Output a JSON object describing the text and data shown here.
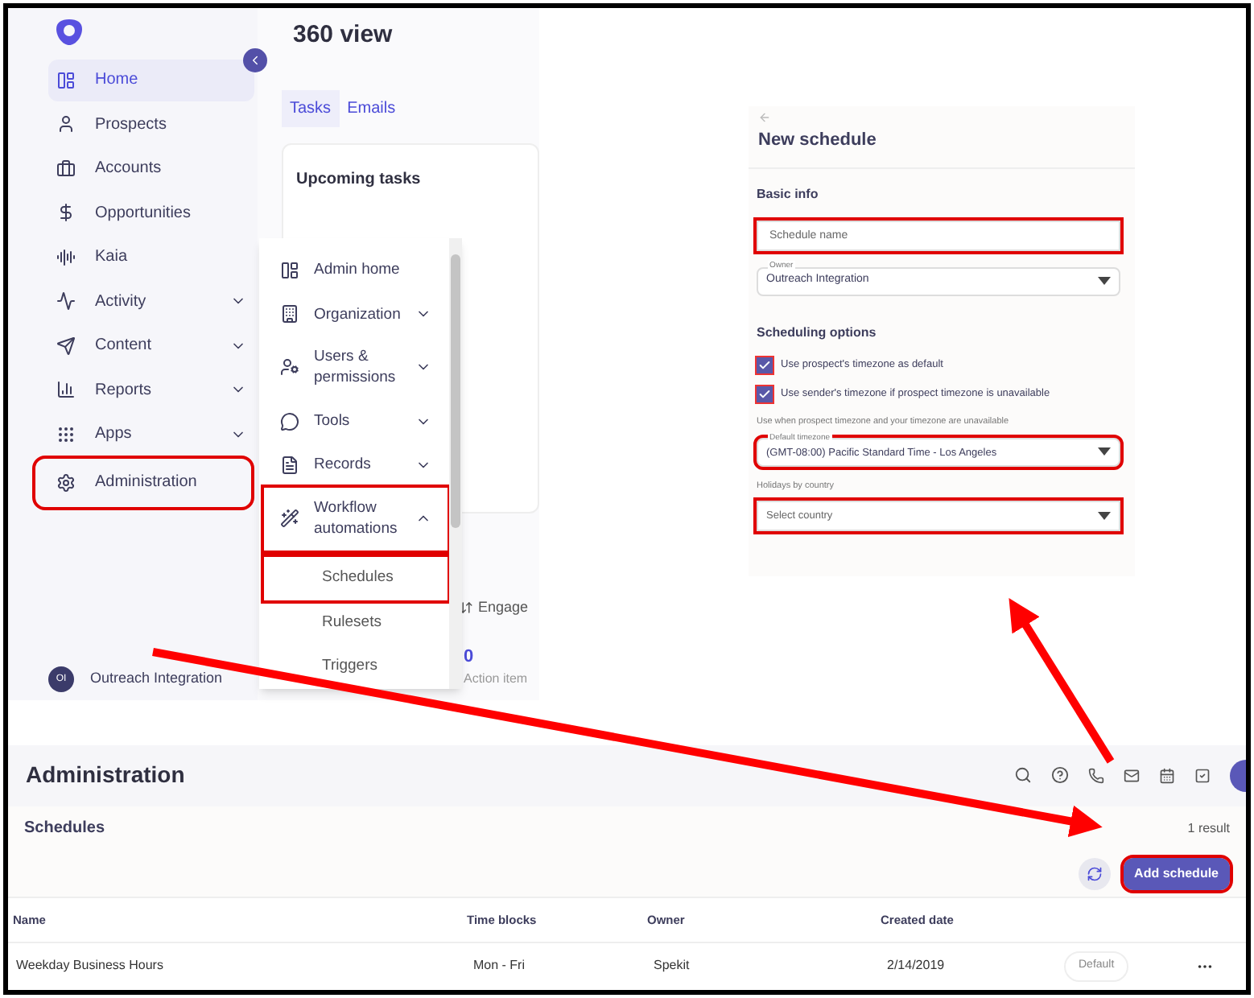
{
  "sidebar": {
    "items": [
      {
        "label": "Home",
        "selected": true,
        "expandable": false,
        "highlighted": false
      },
      {
        "label": "Prospects",
        "selected": false,
        "expandable": false,
        "highlighted": false
      },
      {
        "label": "Accounts",
        "selected": false,
        "expandable": false,
        "highlighted": false
      },
      {
        "label": "Opportunities",
        "selected": false,
        "expandable": false,
        "highlighted": false
      },
      {
        "label": "Kaia",
        "selected": false,
        "expandable": false,
        "highlighted": false
      },
      {
        "label": "Activity",
        "selected": false,
        "expandable": true,
        "highlighted": false
      },
      {
        "label": "Content",
        "selected": false,
        "expandable": true,
        "highlighted": false
      },
      {
        "label": "Reports",
        "selected": false,
        "expandable": true,
        "highlighted": false
      },
      {
        "label": "Apps",
        "selected": false,
        "expandable": true,
        "highlighted": false
      },
      {
        "label": "Administration",
        "selected": false,
        "expandable": false,
        "highlighted": true
      }
    ],
    "user": {
      "initials": "OI",
      "name": "Outreach Integration"
    }
  },
  "admin_menu": {
    "items": [
      {
        "label": "Admin home",
        "kind": "link",
        "expanded": false,
        "highlighted": false
      },
      {
        "label": "Organization",
        "kind": "group",
        "expanded": false,
        "highlighted": false
      },
      {
        "label": "Users & permissions",
        "kind": "group",
        "expanded": false,
        "highlighted": false
      },
      {
        "label": "Tools",
        "kind": "group",
        "expanded": false,
        "highlighted": false
      },
      {
        "label": "Records",
        "kind": "group",
        "expanded": false,
        "highlighted": false
      },
      {
        "label": "Workflow automations",
        "kind": "group",
        "expanded": true,
        "highlighted": true,
        "children": [
          {
            "label": "Schedules",
            "highlighted": true
          },
          {
            "label": "Rulesets",
            "highlighted": false
          },
          {
            "label": "Triggers",
            "highlighted": false
          }
        ]
      }
    ]
  },
  "main": {
    "title": "360 view",
    "tabs": [
      {
        "label": "Tasks",
        "selected": true
      },
      {
        "label": "Emails",
        "selected": false
      }
    ],
    "card_title": "Upcoming tasks",
    "sort_label": "Engage",
    "count": "0",
    "count_label": "Action item"
  },
  "new_schedule": {
    "title": "New schedule",
    "basic_info": "Basic info",
    "name_field": {
      "placeholder": "Schedule name",
      "highlighted": true
    },
    "owner_select": {
      "label": "Owner",
      "value": "Outreach Integration",
      "highlighted": false
    },
    "options_title": "Scheduling options",
    "checkboxes": [
      {
        "label": "Use prospect's timezone as default",
        "checked": true,
        "highlighted": true
      },
      {
        "label": "Use sender's timezone if prospect timezone is unavailable",
        "checked": true,
        "highlighted": true
      }
    ],
    "hint": "Use when prospect timezone and your timezone are unavailable",
    "timezone_select": {
      "label": "Default timezone",
      "value": "(GMT-08:00) Pacific Standard Time - Los Angeles",
      "highlighted": true
    },
    "holidays_label": "Holidays by country",
    "country_select": {
      "placeholder": "Select country",
      "highlighted": true
    }
  },
  "administration": {
    "title": "Administration",
    "section": "Schedules",
    "result_count": "1 result",
    "add_button": {
      "label": "Add schedule",
      "highlighted": true
    },
    "table": {
      "columns": [
        "Name",
        "Time blocks",
        "Owner",
        "Created date"
      ],
      "rows": [
        {
          "cells": [
            "Weekday Business Hours",
            "Mon - Fri",
            "Spekit",
            "2/14/2019"
          ],
          "badge": "Default"
        }
      ]
    }
  }
}
